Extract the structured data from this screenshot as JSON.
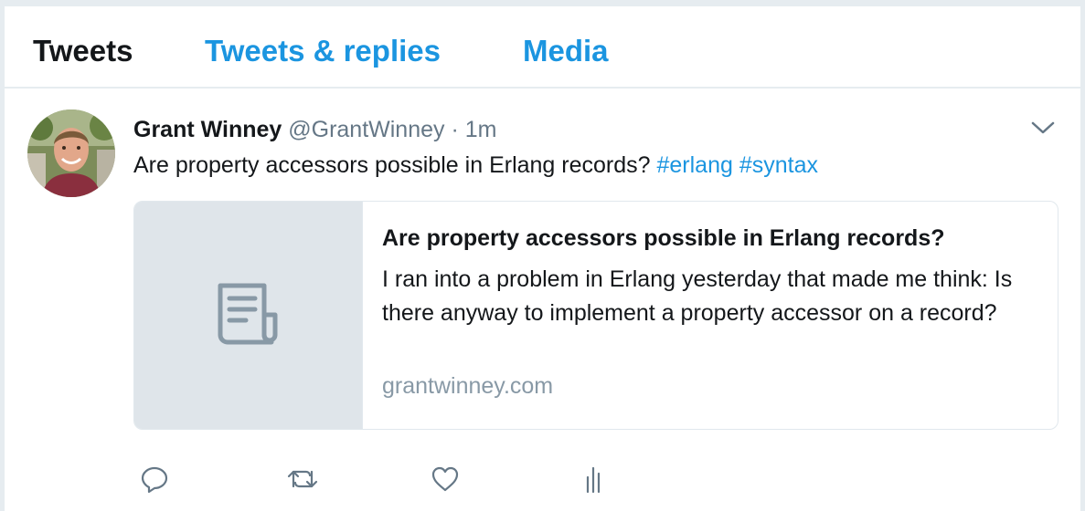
{
  "tabs": {
    "tweets": "Tweets",
    "replies": "Tweets & replies",
    "media": "Media"
  },
  "tweet": {
    "author_name": "Grant Winney",
    "author_handle": "@GrantWinney",
    "separator": "·",
    "time": "1m",
    "text_plain": "Are property accessors possible in Erlang records?",
    "hashtags": [
      "#erlang",
      "#syntax"
    ],
    "card": {
      "title": "Are property accessors possible in Erlang records?",
      "description": "I ran into a problem in Erlang yesterday that made me think: Is there anyway to implement a property accessor on a record?",
      "domain": "grantwinney.com",
      "thumbnail_icon": "document-icon"
    },
    "actions": [
      "reply-icon",
      "retweet-icon",
      "like-icon",
      "analytics-icon"
    ]
  },
  "colors": {
    "link": "#1b95e0",
    "text": "#14171a",
    "muted": "#657786",
    "background": "#e6ecf0",
    "card_thumb": "#dfe5ea"
  }
}
